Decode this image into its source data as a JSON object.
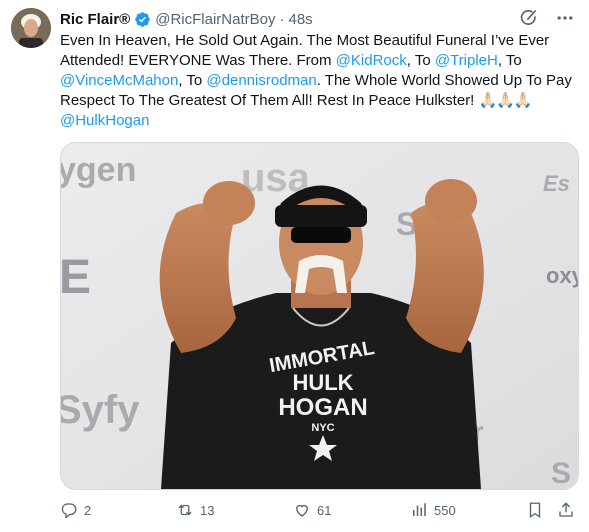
{
  "author": {
    "name": "Ric Flair®",
    "handle": "@RicFlairNatrBoy",
    "separator": "·",
    "time": "48s"
  },
  "tweet": {
    "text_1": "Even In Heaven, He Sold Out Again. The Most Beautiful Funeral I’ve Ever Attended! EVERYONE Was There. From ",
    "mention_1": "@KidRock",
    "text_2": ", To ",
    "mention_2": "@TripleH",
    "text_3": ", To ",
    "mention_3": "@VinceMcMahon",
    "text_4": ", To ",
    "mention_4": "@dennisrodman",
    "text_5": ". The Whole World Showed Up To Pay Respect To The Greatest Of Them All! Rest In Peace Hulkster! ",
    "emoji": "🙏🏻🙏🏻🙏🏻",
    "mention_5": "@HulkHogan"
  },
  "image": {
    "backdrop_words": [
      "ygen",
      "usa",
      "Syfy",
      "E",
      "oxy",
      "Syfy",
      "chiller",
      "Es",
      "S",
      "ox"
    ],
    "shirt_lines": [
      "IMMORTAL",
      "HULK",
      "HOGAN",
      "NYC"
    ]
  },
  "actions": {
    "replies": "2",
    "reposts": "13",
    "likes": "61",
    "views": "550"
  },
  "colors": {
    "accent": "#1d9bf0",
    "muted": "#536471",
    "verified": "#1d9bf0"
  },
  "icons": [
    "verified-badge-icon",
    "grok-icon",
    "more-icon",
    "reply-icon",
    "repost-icon",
    "like-icon",
    "views-icon",
    "bookmark-icon",
    "share-icon"
  ]
}
